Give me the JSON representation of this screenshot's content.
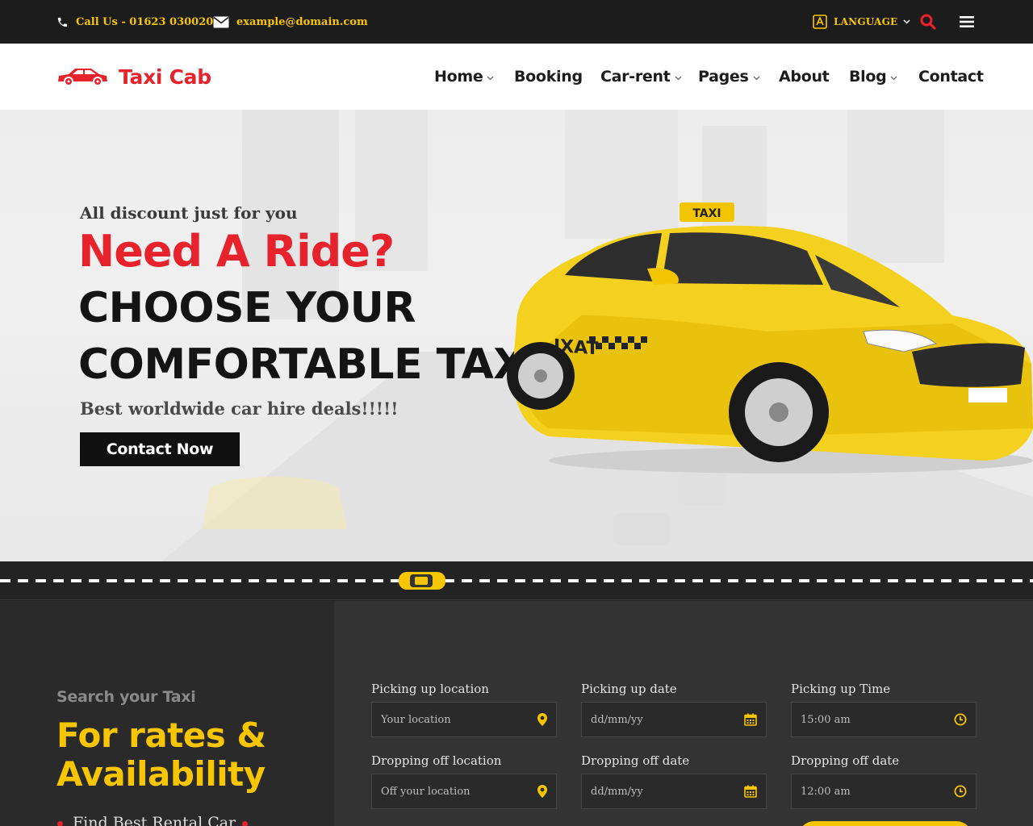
{
  "topbar": {
    "phone": "Call Us - 01623 030020",
    "email": "example@domain.com",
    "language": "LANGUAGE"
  },
  "header": {
    "logo_text": "Taxi Cab",
    "nav": [
      {
        "label": "Home",
        "has_dropdown": true
      },
      {
        "label": "Booking",
        "has_dropdown": false
      },
      {
        "label": "Car-rent",
        "has_dropdown": true
      },
      {
        "label": "Pages",
        "has_dropdown": true
      },
      {
        "label": "About",
        "has_dropdown": false
      },
      {
        "label": "Blog",
        "has_dropdown": true
      },
      {
        "label": "Contact",
        "has_dropdown": false
      }
    ]
  },
  "hero": {
    "tagline": "All discount just for you",
    "headline_red": "Need A Ride?",
    "headline_line1": "CHOOSE YOUR",
    "headline_line2": "COMFORTABLE TAXI",
    "subline": "Best worldwide car hire deals!!!!!",
    "cta_label": "Contact Now",
    "taxi_sign": "TAXI",
    "taxi_door_text": "IXAT"
  },
  "booking": {
    "kicker": "Search your Taxi",
    "title_line1": "For rates &",
    "title_line2": "Availability",
    "feature": "Find Best Rental Car",
    "fields": [
      {
        "label": "Picking up location",
        "placeholder": "Your location",
        "icon": "map-pin-icon"
      },
      {
        "label": "Picking up date",
        "placeholder": "dd/mm/yy",
        "icon": "calendar-icon"
      },
      {
        "label": "Picking up Time",
        "placeholder": "15:00 am",
        "icon": "clock-icon"
      },
      {
        "label": "Dropping off location",
        "placeholder": "Off your location",
        "icon": "map-pin-icon"
      },
      {
        "label": "Dropping off date",
        "placeholder": "dd/mm/yy",
        "icon": "calendar-icon"
      },
      {
        "label": "Dropping off date",
        "placeholder": "12:00 am",
        "icon": "clock-icon"
      }
    ]
  },
  "colors": {
    "accent_yellow": "#f7c600",
    "brand_red": "#e6232d",
    "dark": "#1c1c1c"
  }
}
